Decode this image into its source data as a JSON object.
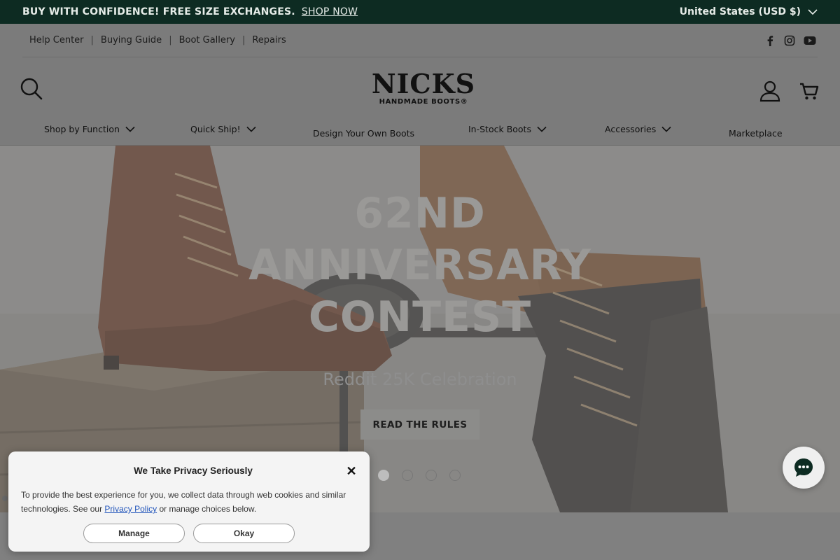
{
  "announcement": {
    "message": "BUY WITH CONFIDENCE! FREE SIZE EXCHANGES.",
    "link": "SHOP NOW",
    "region": "United States (USD $)"
  },
  "utility_links": [
    "Help Center",
    "Buying Guide",
    "Boot Gallery",
    "Repairs"
  ],
  "social_icons": [
    "facebook-icon",
    "instagram-icon",
    "youtube-icon"
  ],
  "logo": {
    "main": "NICKS",
    "tagline": "HANDMADE BOOTS®"
  },
  "nav": [
    {
      "label": "Shop by Function",
      "dropdown": true
    },
    {
      "label": "Quick Ship!",
      "dropdown": true
    },
    {
      "label": "Design Your Own Boots",
      "dropdown": false
    },
    {
      "label": "In-Stock Boots",
      "dropdown": true
    },
    {
      "label": "Accessories",
      "dropdown": true
    },
    {
      "label": "Marketplace",
      "dropdown": false
    }
  ],
  "hero": {
    "title_lines": [
      "62ND",
      "ANNIVERSARY",
      "CONTEST"
    ],
    "subtitle": "Reddit 25K Celebration",
    "cta": "READ THE RULES",
    "slide_count": 4,
    "active_slide": 1
  },
  "privacy": {
    "title": "We Take Privacy Seriously",
    "body_before": "To provide the best experience for you, we collect data through web cookies and similar technologies. See our ",
    "link": "Privacy Policy",
    "body_after": " or manage choices below.",
    "manage": "Manage",
    "okay": "Okay",
    "close": "✕"
  },
  "colors": {
    "announcement_bg": "#0d2b22",
    "overlay_gray": "#7f7f7f"
  }
}
